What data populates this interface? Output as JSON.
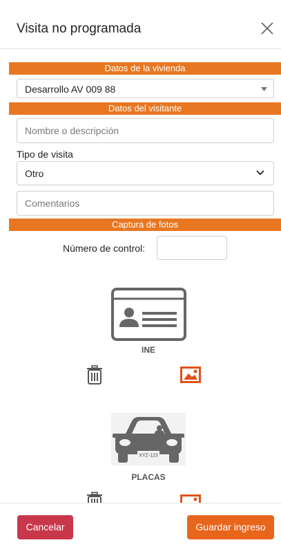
{
  "modal": {
    "title": "Visita no programada"
  },
  "sections": {
    "vivienda": "Datos de la vivienda",
    "visitante": "Datos del visitante",
    "fotos": "Captura de fotos"
  },
  "vivienda_select": {
    "value": "Desarrollo AV 009 88"
  },
  "visitor": {
    "name_placeholder": "Nombre o descripción",
    "tipo_label": "Tipo de visita",
    "tipo_value": "Otro",
    "comments_placeholder": "Comentarios"
  },
  "photos": {
    "control_label": "Número de control:",
    "control_value": "",
    "ine_caption": "INE",
    "placas_caption": "PLACAS",
    "plate_text": "XYZ-123"
  },
  "footer": {
    "cancel_label": "Cancelar",
    "save_label": "Guardar ingreso"
  },
  "colors": {
    "accent": "#e87722",
    "danger": "#c8374a",
    "save": "#e8651c",
    "icon_gray": "#666666"
  },
  "icons": [
    "close-icon",
    "caret-down-icon",
    "chevron-down-icon",
    "id-card-icon",
    "trash-icon",
    "image-icon",
    "car-icon"
  ]
}
